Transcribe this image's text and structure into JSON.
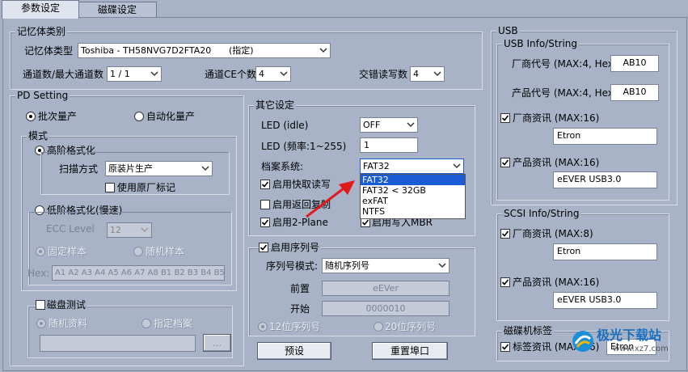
{
  "tabs": [
    {
      "label": "参数设定",
      "active": true
    },
    {
      "label": "磁碟设定",
      "active": false
    }
  ],
  "memory": {
    "title": "记忆体类别",
    "type_label": "记忆体类型",
    "type_value": "Toshiba - TH58NVG7D2FTA20",
    "type_note": "(指定)",
    "channels_label": "通道数/最大通道数",
    "channels_value": "1 / 1",
    "ce_label": "通道CE个数",
    "ce_value": "4",
    "interleave_label": "交错读写数",
    "interleave_value": "4"
  },
  "pd": {
    "title": "PD Setting",
    "batch_label": "批次量产",
    "auto_label": "自动化量产",
    "mode_title": "模式",
    "high_format_label": "高阶格式化",
    "scan_label": "扫描方式",
    "scan_value": "原装片生产",
    "use_original_label": "使用原厂标记",
    "low_format_label": "低阶格式化(慢速)",
    "ecc_label": "ECC Level",
    "ecc_value": "12",
    "fixed_sample_label": "固定样本",
    "random_sample_label": "随机样本",
    "hex_label": "Hex:",
    "hex_value": "A1 A2 A3 A4 A5 A6 A7 A8 B1 B2 B3 B4 B5 B6",
    "disk_test_label": "磁盘测试",
    "random_data_label": "随机资料",
    "specified_file_label": "指定档案",
    "browse_label": "..."
  },
  "other": {
    "title": "其它设定",
    "led_idle_label": "LED (idle)",
    "led_idle_value": "OFF",
    "led_freq_label": "LED (频率:1~255)",
    "led_freq_value": "1",
    "fs_label": "档案系统:",
    "fs_value": "FAT32",
    "fs_options": [
      "FAT32",
      "FAT32 < 32GB",
      "exFAT",
      "NTFS"
    ],
    "quick_rw_label": "启用快取读写",
    "return_copy_label": "启用返回复制",
    "two_plane_label": "启用2-Plane",
    "write_mbr_label": "启用写入MBR"
  },
  "serial": {
    "enable_label": "启用序列号",
    "mode_label": "序列号模式:",
    "mode_value": "随机序列号",
    "prefix_label": "前置",
    "prefix_value": "eEVer",
    "start_label": "开始",
    "start_value": "0000010",
    "digits12_label": "12位序列号",
    "digits20_label": "20位序列号"
  },
  "buttons": {
    "default_label": "预设",
    "reset_port_label": "重置埠口"
  },
  "usb": {
    "title": "USB",
    "info_title": "USB Info/String",
    "vid_label": "厂商代号 (MAX:4, Hex)",
    "vid_value": "AB10",
    "pid_label": "产品代号 (MAX:4, Hex)",
    "pid_value": "AB10",
    "vendor_info_label": "厂商资讯 (MAX:16)",
    "vendor_info_value": "Etron",
    "product_info_label": "产品资讯 (MAX:16)",
    "product_info_value": "eEVER USB3.0"
  },
  "scsi": {
    "title": "SCSI Info/String",
    "vendor_label": "厂商资讯 (MAX:8)",
    "vendor_value": "Etron",
    "product_label": "产品资讯 (MAX:16)",
    "product_value": "eEVER USB3.0"
  },
  "disk_label": {
    "title": "磁碟机标签",
    "label_info": "标签资讯 (MAX:16)",
    "label_value": "Etron"
  },
  "watermark": {
    "title": "极光下载站",
    "url": "www.xz7.com"
  },
  "colors": {
    "background": "#a8b3c8",
    "selection": "#1a5bd6",
    "annotation_arrow": "#e0191c"
  }
}
